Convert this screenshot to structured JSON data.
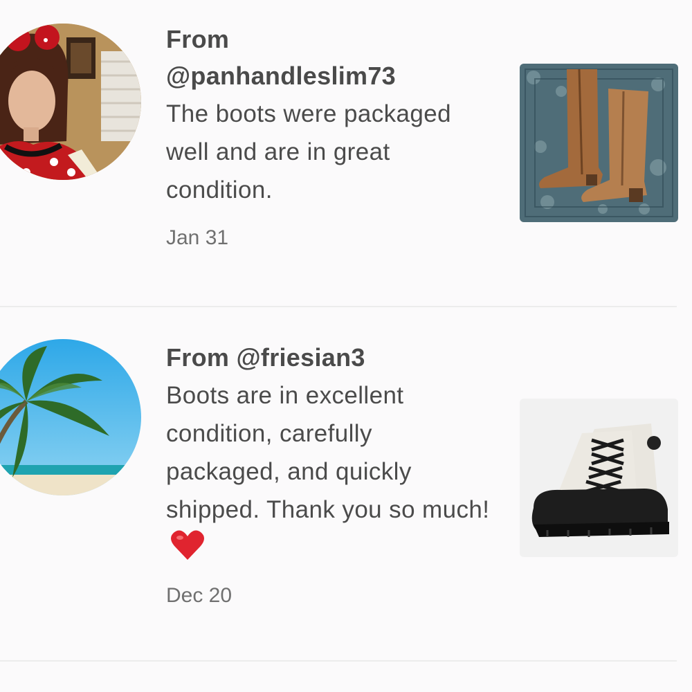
{
  "reviews": [
    {
      "from_line_1": "From",
      "from_line_2": "@panhandleslim73",
      "comment": "The boots were packaged well and are in great condition.",
      "date": "Jan 31",
      "avatar_icon": "user-photo-avatar",
      "product_icon": "brown-leather-boots-photo"
    },
    {
      "from_line": "From @friesian3",
      "comment": "Boots are in excellent condition, carefully packaged, and quickly shipped. Thank you so much!",
      "comment_emoji": "red-heart-icon",
      "date": "Dec 20",
      "avatar_icon": "palm-tree-beach-avatar",
      "product_icon": "black-white-duck-boots-photo"
    }
  ],
  "colors": {
    "background": "#fbfafb",
    "text_primary": "#4a4a4a",
    "text_secondary": "#707070",
    "divider": "#ececec",
    "heart": "#e0242f"
  }
}
